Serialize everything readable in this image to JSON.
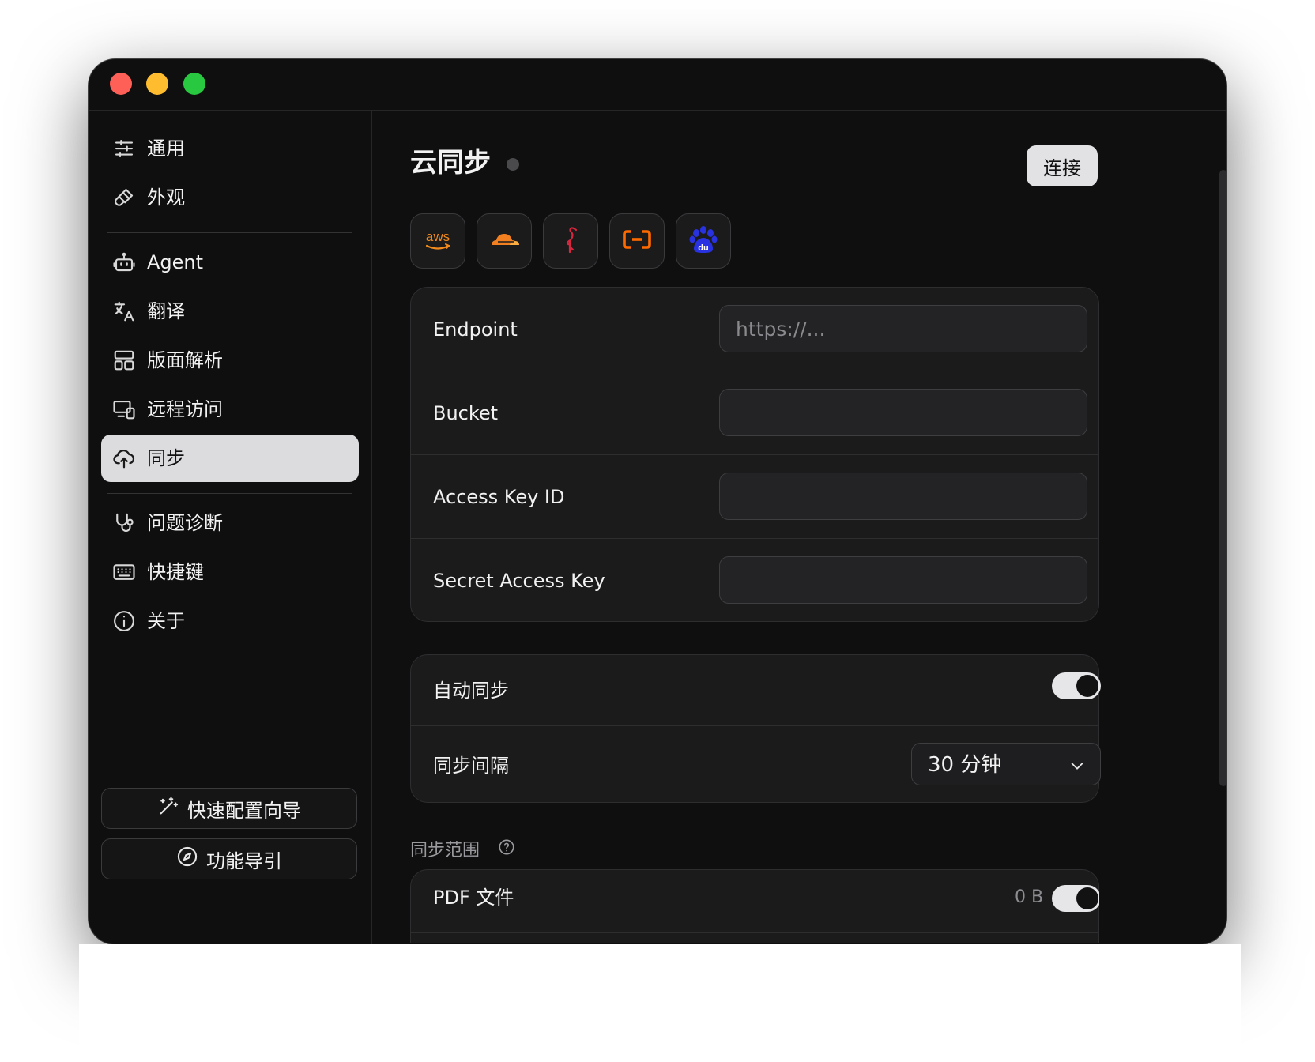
{
  "window": {
    "traffic_lights": [
      {
        "name": "close",
        "color": "#fe5f57"
      },
      {
        "name": "minimize",
        "color": "#febc2e"
      },
      {
        "name": "zoom",
        "color": "#28c840"
      }
    ]
  },
  "sidebar": {
    "items": [
      {
        "label": "通用",
        "icon": "sliders-icon"
      },
      {
        "label": "外观",
        "icon": "brush-icon"
      },
      {
        "label": "Agent",
        "icon": "robot-icon"
      },
      {
        "label": "翻译",
        "icon": "translate-icon"
      },
      {
        "label": "版面解析",
        "icon": "layout-icon"
      },
      {
        "label": "远程访问",
        "icon": "remote-access-icon"
      },
      {
        "label": "同步",
        "icon": "cloud-upload-icon",
        "active": true
      },
      {
        "label": "问题诊断",
        "icon": "stethoscope-icon"
      },
      {
        "label": "快捷键",
        "icon": "keyboard-icon"
      },
      {
        "label": "关于",
        "icon": "info-icon"
      }
    ],
    "quick_setup_label": "快速配置向导",
    "feature_guide_label": "功能导引"
  },
  "main": {
    "title": "云同步",
    "connect_label": "连接",
    "providers": [
      {
        "name": "aws",
        "text": "aws",
        "color": "#f08a1c"
      },
      {
        "name": "cloudflare",
        "color": "#f38020"
      },
      {
        "name": "flamingo",
        "color": "#d8263f"
      },
      {
        "name": "aliyun",
        "color": "#ff6a00"
      },
      {
        "name": "baidu",
        "text": "du",
        "color": "#2932e1"
      }
    ],
    "credentials": {
      "endpoint": {
        "label": "Endpoint",
        "placeholder": "https://...",
        "value": ""
      },
      "bucket": {
        "label": "Bucket",
        "value": ""
      },
      "access_key_id": {
        "label": "Access Key ID",
        "value": ""
      },
      "secret_access_key": {
        "label": "Secret Access Key",
        "value": ""
      }
    },
    "auto_sync": {
      "label": "自动同步",
      "enabled": true
    },
    "sync_interval": {
      "label": "同步间隔",
      "selected": "30 分钟"
    },
    "sync_scope": {
      "heading": "同步范围",
      "items": [
        {
          "label": "PDF 文件",
          "size": "0 B",
          "enabled": true
        }
      ]
    }
  },
  "colors": {
    "window_bg": "#0f0f10",
    "card_bg": "#1b1b1c",
    "active_nav_bg": "#dcdcdf",
    "text_primary": "#f2f2f2"
  }
}
